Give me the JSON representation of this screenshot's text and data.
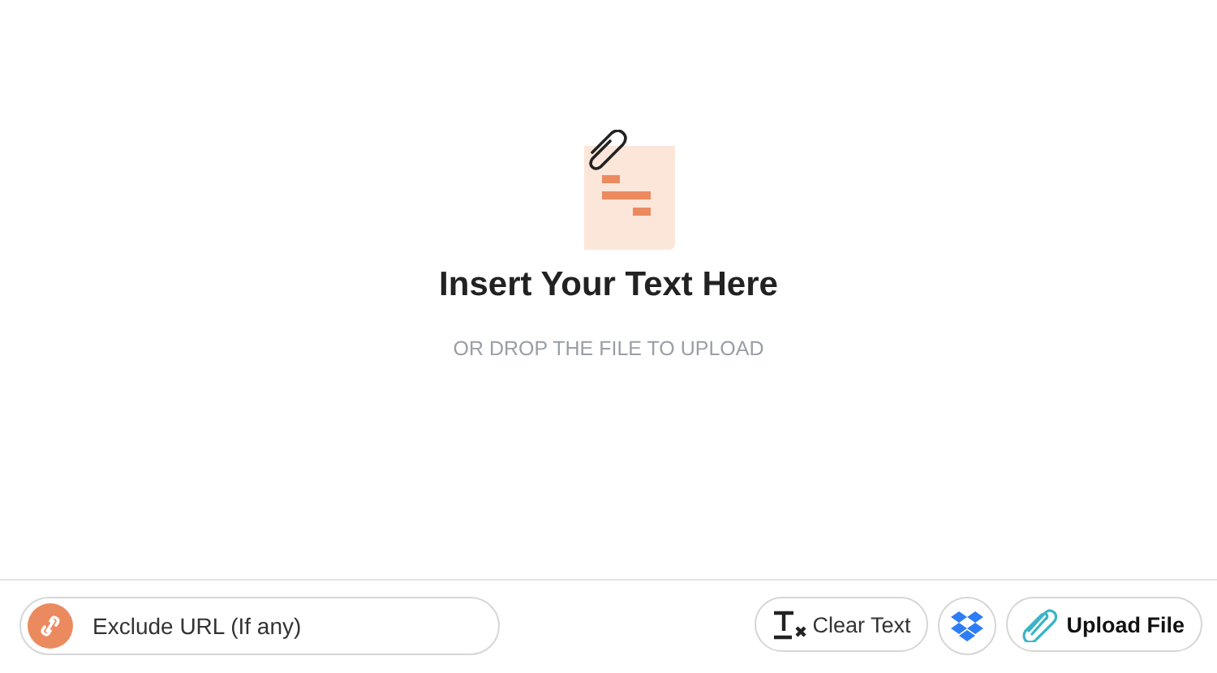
{
  "drop_zone": {
    "title": "Insert Your Text Here",
    "subtitle": "OR DROP THE FILE TO UPLOAD"
  },
  "exclude_url": {
    "placeholder": "Exclude URL (If any)"
  },
  "buttons": [
    {
      "kind": "clear",
      "label": "Clear Text"
    },
    {
      "kind": "dropbox"
    },
    {
      "kind": "upload",
      "label": "Upload File"
    }
  ]
}
